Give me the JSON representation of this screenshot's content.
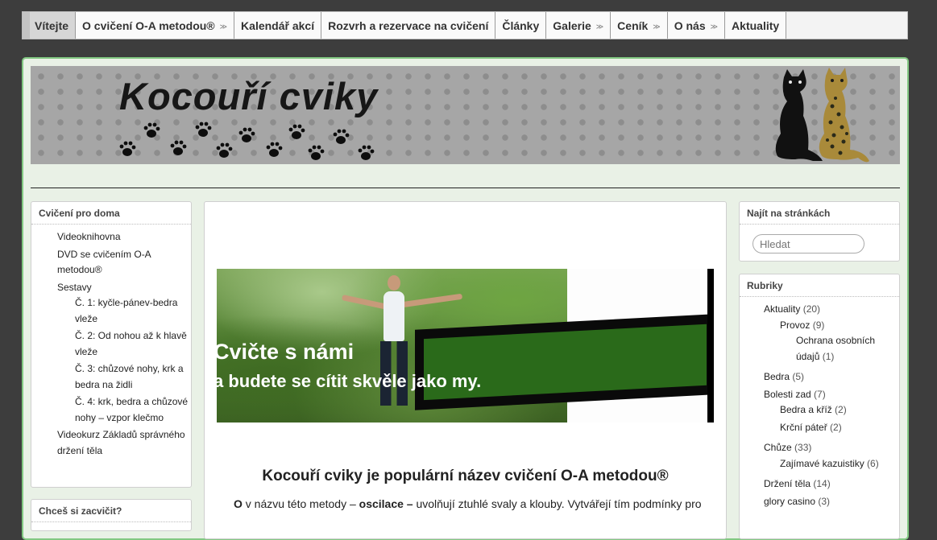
{
  "nav": {
    "items": [
      {
        "label": "Vítejte",
        "has_children": false
      },
      {
        "label": "O cvičení O-A metodou®",
        "has_children": true
      },
      {
        "label": "Kalendář akcí",
        "has_children": false
      },
      {
        "label": "Rozvrh a rezervace na cvičení",
        "has_children": false
      },
      {
        "label": "Články",
        "has_children": false
      },
      {
        "label": "Galerie",
        "has_children": true
      },
      {
        "label": "Ceník",
        "has_children": true
      },
      {
        "label": "O nás",
        "has_children": true
      },
      {
        "label": "Aktuality",
        "has_children": false
      }
    ],
    "chevron": "≫"
  },
  "header": {
    "title": "Kocouří cviky"
  },
  "left_sidebar": {
    "title": "Cvičení pro doma",
    "items": {
      "videoknihovna": "Videoknihovna",
      "dvd": "DVD se cvičením O-A metodou®",
      "sestavy": "Sestavy",
      "sestava1": "Č. 1: kyčle-pánev-bedra vleže",
      "sestava2": "Č. 2: Od nohou až k hlavě vleže",
      "sestava3": "Č. 3: chůzové nohy, krk a bedra na židli",
      "sestava4": "Č. 4: krk, bedra a chůzové nohy – vzpor klečmo",
      "videokurz": "Videokurz Základů správného držení těla"
    },
    "second_title": "Chceš si zacvičit?"
  },
  "banner": {
    "line1": "Cvičte s námi",
    "line2": "a budete se cítit skvěle jako my."
  },
  "main": {
    "heading": "Kocouří cviky je populární název cvičení O-A metodou®",
    "para_bold1": "O",
    "para_text1": " v názvu této metody – ",
    "para_bold2": "oscilace –",
    "para_text2": " uvolňují ztuhlé svaly a klouby. Vytvářejí tím podmínky pro"
  },
  "search": {
    "title": "Najít na stránkách",
    "placeholder": "Hledat"
  },
  "categories": {
    "title": "Rubriky",
    "aktuality": {
      "label": "Aktuality",
      "count": "(20)"
    },
    "provoz": {
      "label": "Provoz",
      "count": "(9)"
    },
    "ochrana": {
      "label": "Ochrana osobních údajů",
      "count": "(1)"
    },
    "bedra": {
      "label": "Bedra",
      "count": "(5)"
    },
    "bolesti": {
      "label": "Bolesti zad",
      "count": "(7)"
    },
    "bedrakriz": {
      "label": "Bedra a kříž",
      "count": "(2)"
    },
    "krcni": {
      "label": "Krční páteř",
      "count": "(2)"
    },
    "chuze": {
      "label": "Chůze",
      "count": "(33)"
    },
    "kazuistiky": {
      "label": "Zajímavé kazuistiky",
      "count": "(6)"
    },
    "drzeni": {
      "label": "Držení těla",
      "count": "(14)"
    },
    "casino": {
      "label": "glory casino",
      "count": "(3)"
    }
  },
  "colors": {
    "frame_border": "#82c882",
    "frame_bg": "#e9f1e6",
    "banner_green": "#2a6a1a"
  }
}
